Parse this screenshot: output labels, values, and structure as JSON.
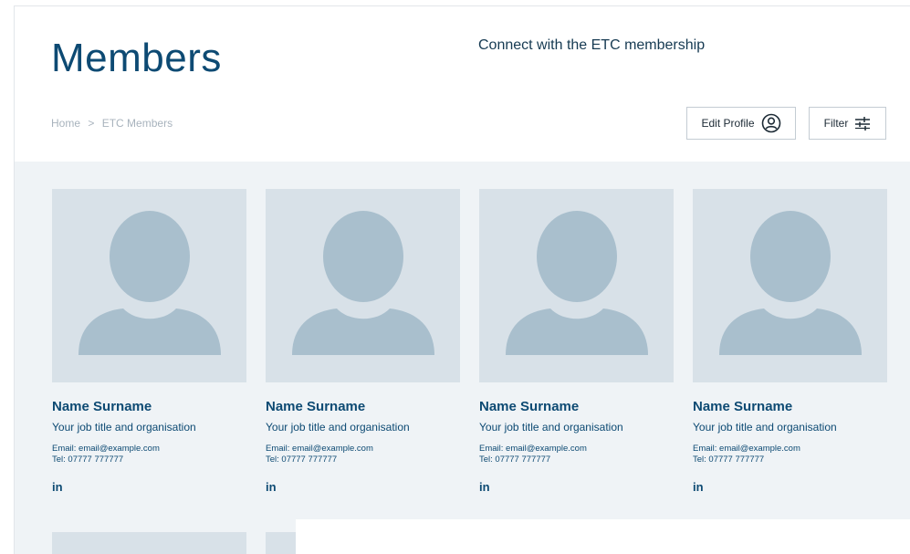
{
  "header": {
    "title": "Members",
    "tagline": "Connect with the ETC membership"
  },
  "breadcrumb": {
    "home": "Home",
    "separator": ">",
    "current": "ETC Members"
  },
  "actions": {
    "edit_profile_label": "Edit Profile",
    "edit_profile_icon": "user-circle-icon",
    "filter_label": "Filter",
    "filter_icon": "sliders-icon"
  },
  "members": [
    {
      "name": "Name Surname",
      "job": "Your job title and organisation",
      "email": "Email: email@example.com",
      "tel": "Tel: 07777 777777",
      "social": "in"
    },
    {
      "name": "Name Surname",
      "job": "Your job title and organisation",
      "email": "Email: email@example.com",
      "tel": "Tel: 07777 777777",
      "social": "in"
    },
    {
      "name": "Name Surname",
      "job": "Your job title and organisation",
      "email": "Email: email@example.com",
      "tel": "Tel: 07777 777777",
      "social": "in"
    },
    {
      "name": "Name Surname",
      "job": "Your job title and organisation",
      "email": "Email: email@example.com",
      "tel": "Tel: 07777 777777",
      "social": "in"
    }
  ],
  "colors": {
    "primary": "#0d4a73",
    "page_bg": "#eff3f6",
    "avatar_bg": "#d8e1e8",
    "avatar_fg": "#a9bfcd"
  }
}
